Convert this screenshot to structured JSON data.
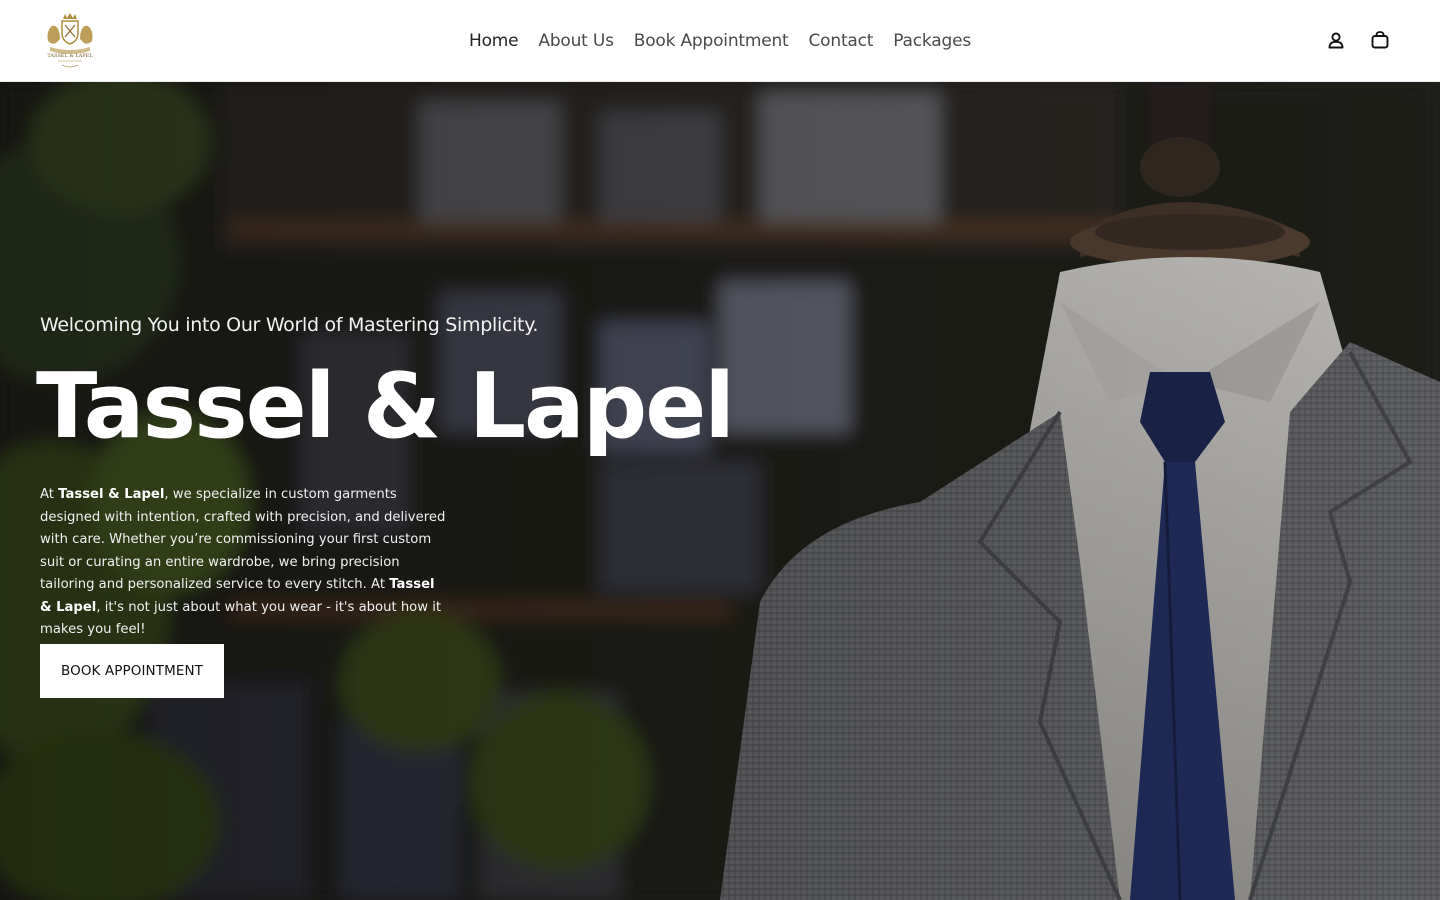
{
  "brand": {
    "name": "TASSEL & LAPEL",
    "logo_icon": "crest-logo-icon",
    "accent_color": "#b08d3c"
  },
  "nav": {
    "items": [
      {
        "label": "Home",
        "active": true
      },
      {
        "label": "About Us",
        "active": false
      },
      {
        "label": "Book Appointment",
        "active": false
      },
      {
        "label": "Contact",
        "active": false
      },
      {
        "label": "Packages",
        "active": false
      }
    ]
  },
  "header_icons": {
    "account_icon": "account-icon",
    "cart_icon": "cart-icon"
  },
  "hero": {
    "kicker": "Welcoming You into Our World of Mastering Simplicity.",
    "title": "Tassel & Lapel",
    "desc_parts": [
      "At ",
      "Tassel & Lapel",
      ", we specialize in custom garments designed with intention, crafted with precision, and delivered with care. Whether you’re commissioning your first custom suit or curating an entire wardrobe, we bring precision tailoring and personalized service to every stitch. At ",
      "Tassel & Lapel",
      ", it's not just about what you wear - it's about how it makes you feel!"
    ],
    "cta_label": "BOOK APPOINTMENT"
  }
}
